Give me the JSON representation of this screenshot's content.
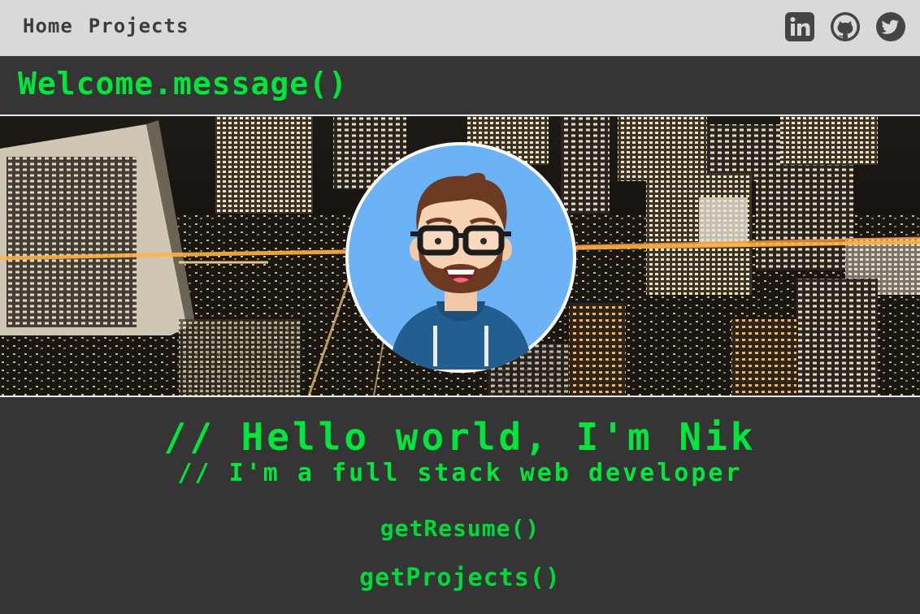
{
  "nav": {
    "links": [
      {
        "label": "Home"
      },
      {
        "label": "Projects"
      }
    ],
    "social": [
      {
        "icon": "linkedin-icon"
      },
      {
        "icon": "github-icon"
      },
      {
        "icon": "twitter-icon"
      }
    ]
  },
  "welcome": {
    "title": "Welcome.message()"
  },
  "hero": {
    "background": "night-city-skyline",
    "avatar": "developer-avatar"
  },
  "intro": {
    "hello": "// Hello world, I'm Nik",
    "subtitle": "// I'm a full stack web developer"
  },
  "actions": {
    "resume": "getResume()",
    "projects": "getProjects()"
  },
  "colors": {
    "accent": "#00e63a",
    "background": "#353535",
    "nav_background": "#d9d9d9",
    "nav_text": "#3d3d3d"
  }
}
